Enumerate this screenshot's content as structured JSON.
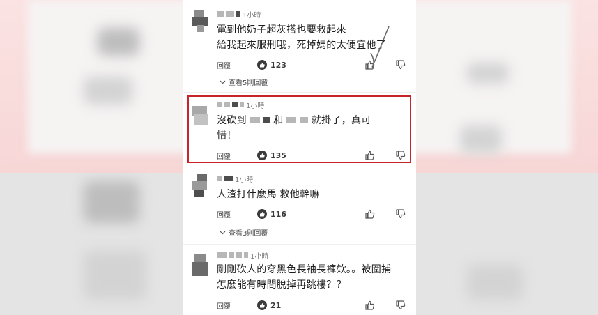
{
  "comments": [
    {
      "time": "1小時",
      "lines": [
        "電到他奶子超灰搭也要救起來",
        "給我起來服刑哦，死掉媽的太便宜他了"
      ],
      "reply_label": "回覆",
      "likes": "123",
      "view_replies": "查看5則回覆"
    },
    {
      "time": "1小時",
      "lines": [
        "沒砍到",
        "和",
        "就掛了，真可",
        "惜！"
      ],
      "reply_label": "回覆",
      "likes": "135"
    },
    {
      "time": "1小時",
      "lines": [
        "人渣打什麼馬 救他幹嘛"
      ],
      "reply_label": "回覆",
      "likes": "116",
      "view_replies": "查看3則回覆"
    },
    {
      "time": "1小時",
      "lines": [
        "剛剛砍人的穿黑色長袖長褲欸。。被圍捕",
        "怎麼能有時間脫掉再跳樓？？"
      ],
      "reply_label": "回覆",
      "likes": "21"
    }
  ],
  "colors": {
    "highlight": "#c8252b",
    "band": "#f7d6d6"
  },
  "icons": [
    "like-icon",
    "thumbs-up-icon",
    "thumbs-down-icon",
    "chevron-down-icon"
  ]
}
